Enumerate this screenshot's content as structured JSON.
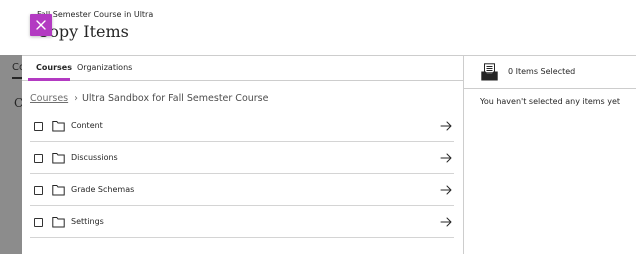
{
  "background": {
    "fragment_1": "Co",
    "fragment_2": "C"
  },
  "header": {
    "subtitle": "Fall Semester Course in Ultra",
    "title": "Copy Items"
  },
  "tabs": [
    {
      "label": "Courses",
      "active": true
    },
    {
      "label": "Organizations",
      "active": false
    }
  ],
  "breadcrumb": {
    "root": "Courses",
    "separator": "›",
    "current": "Ultra Sandbox for Fall Semester Course"
  },
  "items": [
    {
      "label": "Content",
      "checked": false,
      "icon": "folder-icon"
    },
    {
      "label": "Discussions",
      "checked": false,
      "icon": "folder-icon"
    },
    {
      "label": "Grade Schemas",
      "checked": false,
      "icon": "folder-icon"
    },
    {
      "label": "Settings",
      "checked": false,
      "icon": "folder-icon"
    }
  ],
  "selection": {
    "count_text": "0 Items Selected",
    "empty_message": "You haven't selected any items yet",
    "icon": "tray-icon"
  },
  "colors": {
    "accent": "#b33ac2",
    "divider": "#cdcdcd",
    "text": "#262626",
    "overlay": "#8c8c8c"
  }
}
